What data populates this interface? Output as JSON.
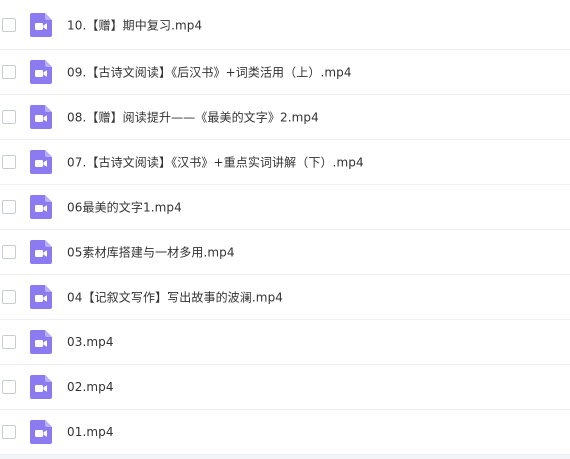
{
  "files": [
    {
      "name": "10.【赠】期中复习.mp4",
      "icon": "video-file-icon"
    },
    {
      "name": "09.【古诗文阅读】《后汉书》+词类活用（上）.mp4",
      "icon": "video-file-icon"
    },
    {
      "name": "08.【赠】阅读提升——《最美的文字》2.mp4",
      "icon": "video-file-icon"
    },
    {
      "name": "07.【古诗文阅读】《汉书》+重点实词讲解（下）.mp4",
      "icon": "video-file-icon"
    },
    {
      "name": "06最美的文字1.mp4",
      "icon": "video-file-icon"
    },
    {
      "name": "05素材库搭建与一材多用.mp4",
      "icon": "video-file-icon"
    },
    {
      "name": "04【记叙文写作】写出故事的波澜.mp4",
      "icon": "video-file-icon"
    },
    {
      "name": "03.mp4",
      "icon": "video-file-icon"
    },
    {
      "name": "02.mp4",
      "icon": "video-file-icon"
    },
    {
      "name": "01.mp4",
      "icon": "video-file-icon"
    }
  ],
  "colors": {
    "icon_body": "#8c7bf0",
    "icon_fold": "#b9aef7",
    "icon_glyph": "#ffffff"
  }
}
